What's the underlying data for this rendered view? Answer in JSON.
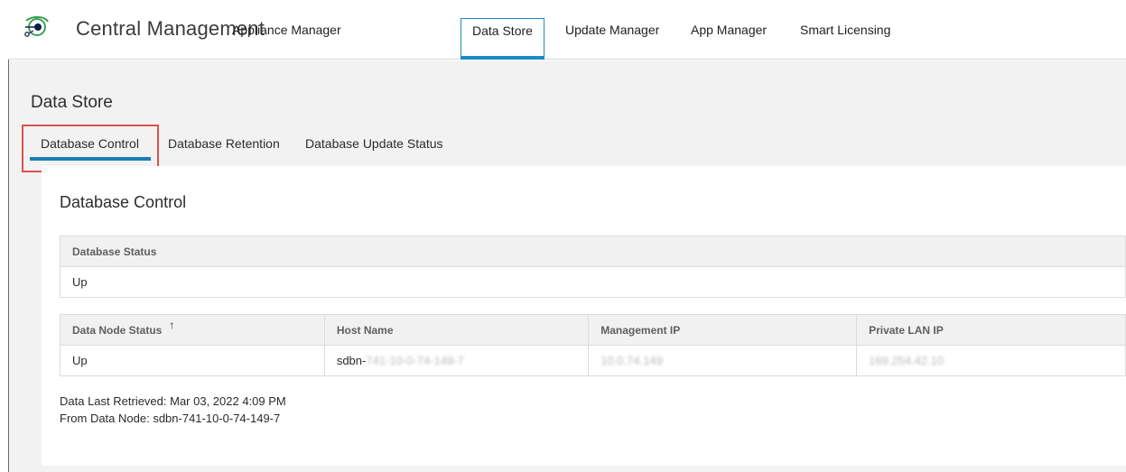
{
  "header": {
    "app_title": "Central Management",
    "nav": [
      {
        "label": "Appliance Manager"
      },
      {
        "label": "Data Store"
      },
      {
        "label": "Update Manager"
      },
      {
        "label": "App Manager"
      },
      {
        "label": "Smart Licensing"
      }
    ],
    "active_nav": "Data Store",
    "logo_icon": "cisco-orbit-logo-icon"
  },
  "page": {
    "title": "Data Store",
    "subtabs": [
      {
        "label": "Database Control"
      },
      {
        "label": "Database Retention"
      },
      {
        "label": "Database Update Status"
      }
    ],
    "active_subtab": "Database Control"
  },
  "panel": {
    "title": "Database Control",
    "status_table": {
      "header": "Database Status",
      "value": "Up"
    },
    "node_table": {
      "columns": [
        "Data Node Status",
        "Host Name",
        "Management IP",
        "Private LAN IP"
      ],
      "sort_icon": "arrow-up-icon",
      "rows": [
        {
          "status": "Up",
          "host_prefix": "sdbn-",
          "host_suffix": "741-10-0-74-149-7",
          "mgmt_ip": "10.0.74.149",
          "lan_ip": "169.254.42.10"
        }
      ]
    },
    "last_retrieved": "Data Last Retrieved: Mar 03, 2022 4:09 PM",
    "from_node": "From Data Node: sdbn-741-10-0-74-149-7"
  },
  "colors": {
    "accent": "#1a8ac6",
    "highlight_box": "#d9534f",
    "background": "#f2f2f2"
  }
}
